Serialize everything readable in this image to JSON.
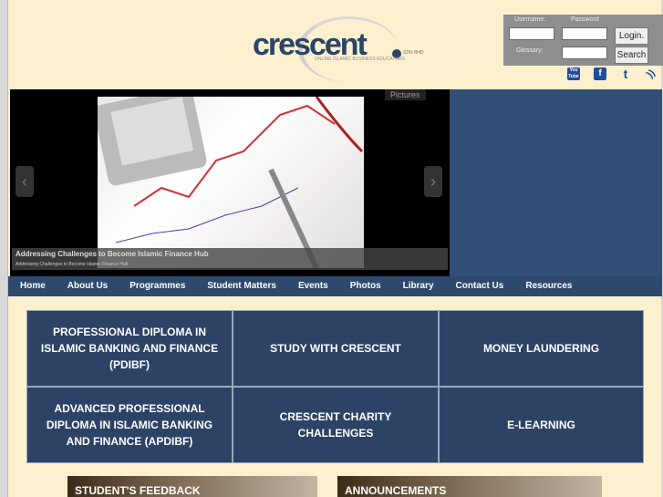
{
  "logo": {
    "name": "crescent",
    "suffix": "SDN BHD",
    "tagline": "ONLINE ISLAMIC BUSINESS EDUCATORS"
  },
  "login": {
    "username_label": "Username:",
    "password_label": "Password",
    "glossary_label": "Glossary:",
    "login_button": "Login.",
    "search_button": "Search"
  },
  "social": [
    {
      "icon": "youtube-icon",
      "text": "You Tube",
      "color": "#1f4e9a"
    },
    {
      "icon": "facebook-icon",
      "text": "f",
      "color": "#1f4e9a"
    },
    {
      "icon": "twitter-icon",
      "text": "t",
      "color": "#1f4e9a"
    },
    {
      "icon": "rss-icon",
      "text": "))",
      "color": "#1f4e9a"
    }
  ],
  "slider": {
    "pictures_label": "Pictures",
    "caption_title": "Addressing Challenges to Become Islamic Finance Hub",
    "caption_sub": "Addressing Challenges to Become Islamic Finance Hub",
    "prev": "‹",
    "next": "›"
  },
  "nav": [
    "Home",
    "About Us",
    "Programmes",
    "Student Matters",
    "Events",
    "Photos",
    "Library",
    "Contact Us",
    "Resources"
  ],
  "programmes": [
    "PROFESSIONAL DIPLOMA IN ISLAMIC BANKING AND FINANCE (PDIBF)",
    "STUDY WITH CRESCENT",
    "MONEY LAUNDERING",
    "ADVANCED PROFESSIONAL DIPLOMA IN ISLAMIC BANKING AND FINANCE (APDIBF)",
    "CRESCENT CHARITY CHALLENGES",
    "E-LEARNING"
  ],
  "sections": {
    "feedback": "STUDENT'S FEEDBACK",
    "announcements": "ANNOUNCEMENTS"
  },
  "colors": {
    "background": "#fdf0cf",
    "primary": "#2d4a6e"
  }
}
